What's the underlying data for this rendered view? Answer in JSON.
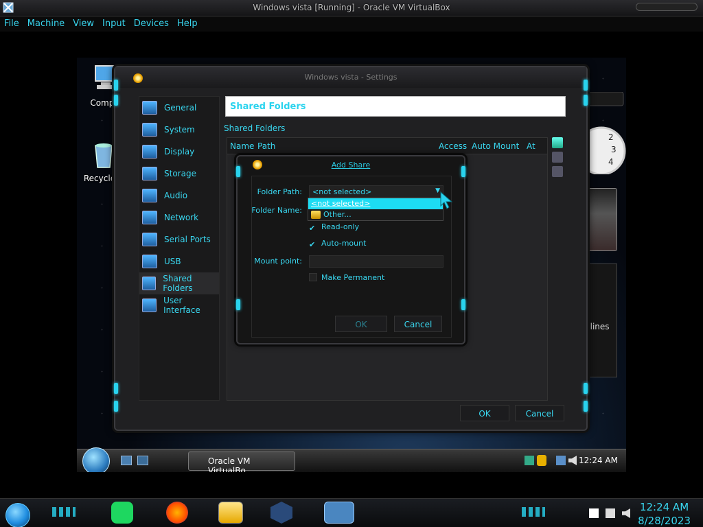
{
  "host": {
    "window_title": "Windows vista [Running] - Oracle VM VirtualBox",
    "menu": [
      "File",
      "Machine",
      "View",
      "Input",
      "Devices",
      "Help"
    ],
    "clock_time": "12:24 AM",
    "clock_date": "8/28/2023"
  },
  "guest": {
    "desktop_icons": {
      "computer": "Comput",
      "recycle_bin": "Recycle B"
    },
    "news_gadget_text": "dlines",
    "taskbar_button": "Oracle VM VirtualBo...",
    "time": "12:24 AM"
  },
  "settings": {
    "title": "Windows vista - Settings",
    "sidebar": [
      {
        "label": "General"
      },
      {
        "label": "System"
      },
      {
        "label": "Display"
      },
      {
        "label": "Storage"
      },
      {
        "label": "Audio"
      },
      {
        "label": "Network"
      },
      {
        "label": "Serial Ports"
      },
      {
        "label": "USB"
      },
      {
        "label": "Shared Folders"
      },
      {
        "label": "User Interface"
      }
    ],
    "header": "Shared Folders",
    "section_label": "Shared Folders",
    "columns": [
      "Name",
      "Path",
      "Access",
      "Auto Mount",
      "At"
    ],
    "ok": "OK",
    "cancel": "Cancel"
  },
  "add_share": {
    "title": "Add Share",
    "folder_path_label": "Folder Path:",
    "folder_path_value": "<not selected>",
    "folder_name_label": "Folder Name:",
    "dropdown": [
      "<not selected>",
      "Other..."
    ],
    "read_only": "Read-only",
    "auto_mount": "Auto-mount",
    "mount_point_label": "Mount point:",
    "make_permanent": "Make Permanent",
    "ok": "OK",
    "cancel": "Cancel"
  }
}
